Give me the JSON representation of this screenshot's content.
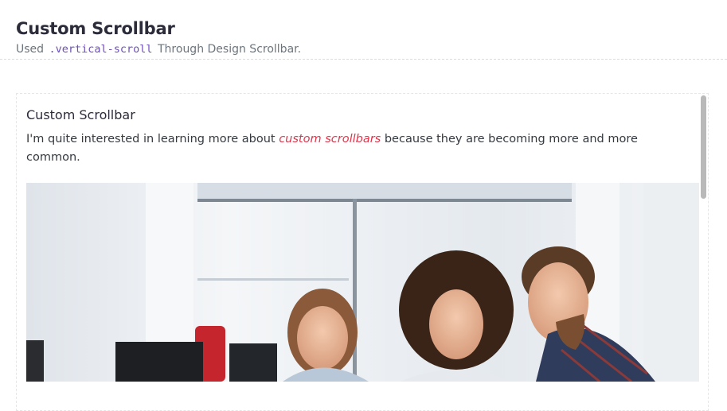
{
  "header": {
    "title": "Custom Scrollbar",
    "subtitle_prefix": "Used",
    "subtitle_code": ".vertical-scroll",
    "subtitle_suffix": "Through Design Scrollbar."
  },
  "card": {
    "title": "Custom Scrollbar",
    "text_before": "I'm quite interested in learning more about",
    "text_highlight": "custom scrollbars",
    "text_after": "because they are becoming more and more common.",
    "image_alt": "Three colleagues smiling at a laptop in an office"
  },
  "colors": {
    "highlight": "#e1344a",
    "code": "#6f4fb8",
    "scrollbar_thumb": "#b9b9b9"
  },
  "icons": {}
}
